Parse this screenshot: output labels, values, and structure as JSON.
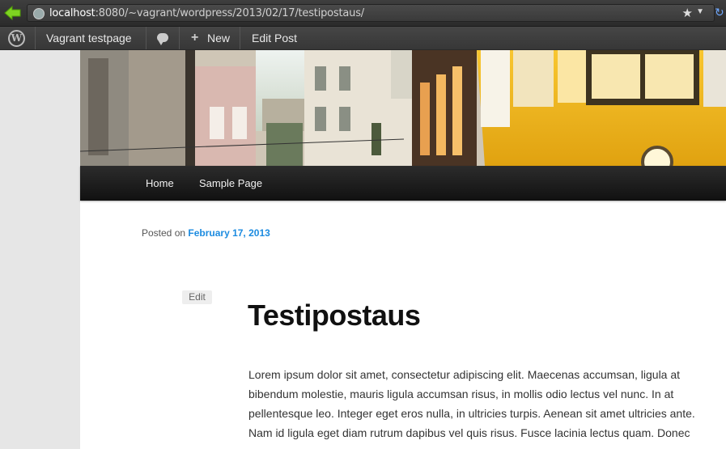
{
  "browser": {
    "url_host": "localhost",
    "url_path": ":8080/~vagrant/wordpress/2013/02/17/testipostaus/"
  },
  "admin_bar": {
    "site_name": "Vagrant testpage",
    "new_label": "New",
    "edit_post_label": "Edit Post"
  },
  "nav": {
    "items": [
      {
        "label": "Home"
      },
      {
        "label": "Sample Page"
      }
    ]
  },
  "post": {
    "posted_on_label": "Posted on",
    "date": "February 17, 2013",
    "edit_label": "Edit",
    "title": "Testipostaus",
    "body": "Lorem ipsum dolor sit amet, consectetur adipiscing elit. Maecenas accumsan, ligula at bibendum molestie, mauris ligula accumsan risus, in mollis odio lectus vel nunc. In at pellentesque leo. Integer eget eros nulla, in ultricies turpis. Aenean sit amet ultricies ante. Nam id ligula eget diam rutrum dapibus vel quis risus. Fusce lacinia lectus quam. Donec"
  }
}
